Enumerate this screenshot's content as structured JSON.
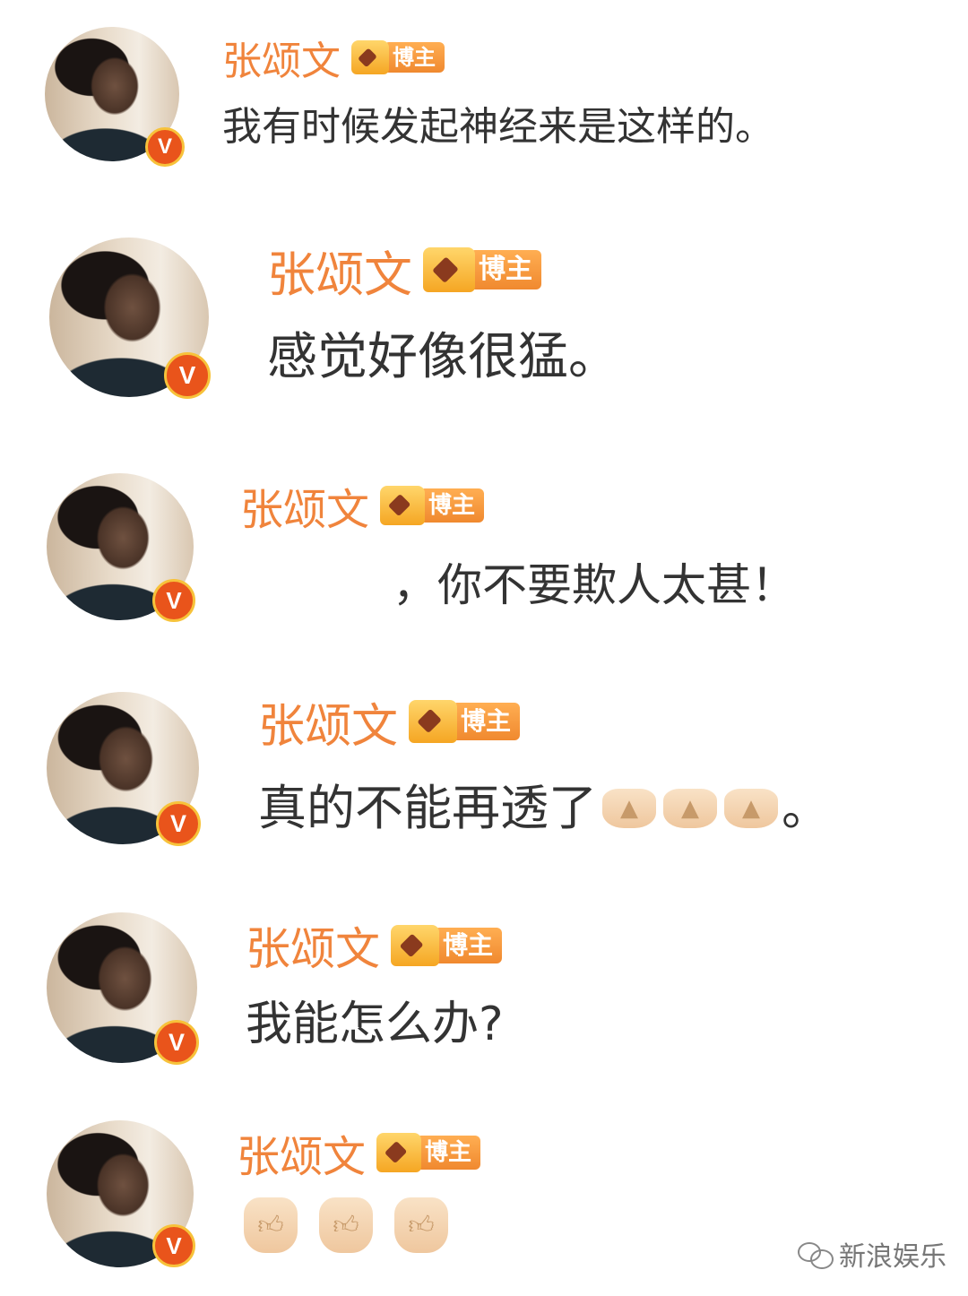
{
  "comments": [
    {
      "author": "张颂文",
      "badge": "博主",
      "verified": "V",
      "text": "我有时候发起神经来是这样的。"
    },
    {
      "author": "张颂文",
      "badge": "博主",
      "verified": "V",
      "text": "感觉好像很猛。"
    },
    {
      "author": "张颂文",
      "badge": "博主",
      "verified": "V",
      "text": "，你不要欺人太甚！"
    },
    {
      "author": "张颂文",
      "badge": "博主",
      "verified": "V",
      "text": "真的不能再透了",
      "emojis": [
        "folded-hands-emoji",
        "folded-hands-emoji",
        "folded-hands-emoji"
      ],
      "suffix": "。"
    },
    {
      "author": "张颂文",
      "badge": "博主",
      "verified": "V",
      "text": "我能怎么办?"
    },
    {
      "author": "张颂文",
      "badge": "博主",
      "verified": "V",
      "emojis": [
        "thumbs-up-emoji",
        "thumbs-up-emoji",
        "thumbs-up-emoji"
      ]
    }
  ],
  "watermark": {
    "text": "新浪娱乐",
    "icon": "wechat-icon"
  },
  "colors": {
    "name": "#f0843c",
    "badge": "#f0892f",
    "text": "#333333",
    "verified": "#e9541b"
  }
}
